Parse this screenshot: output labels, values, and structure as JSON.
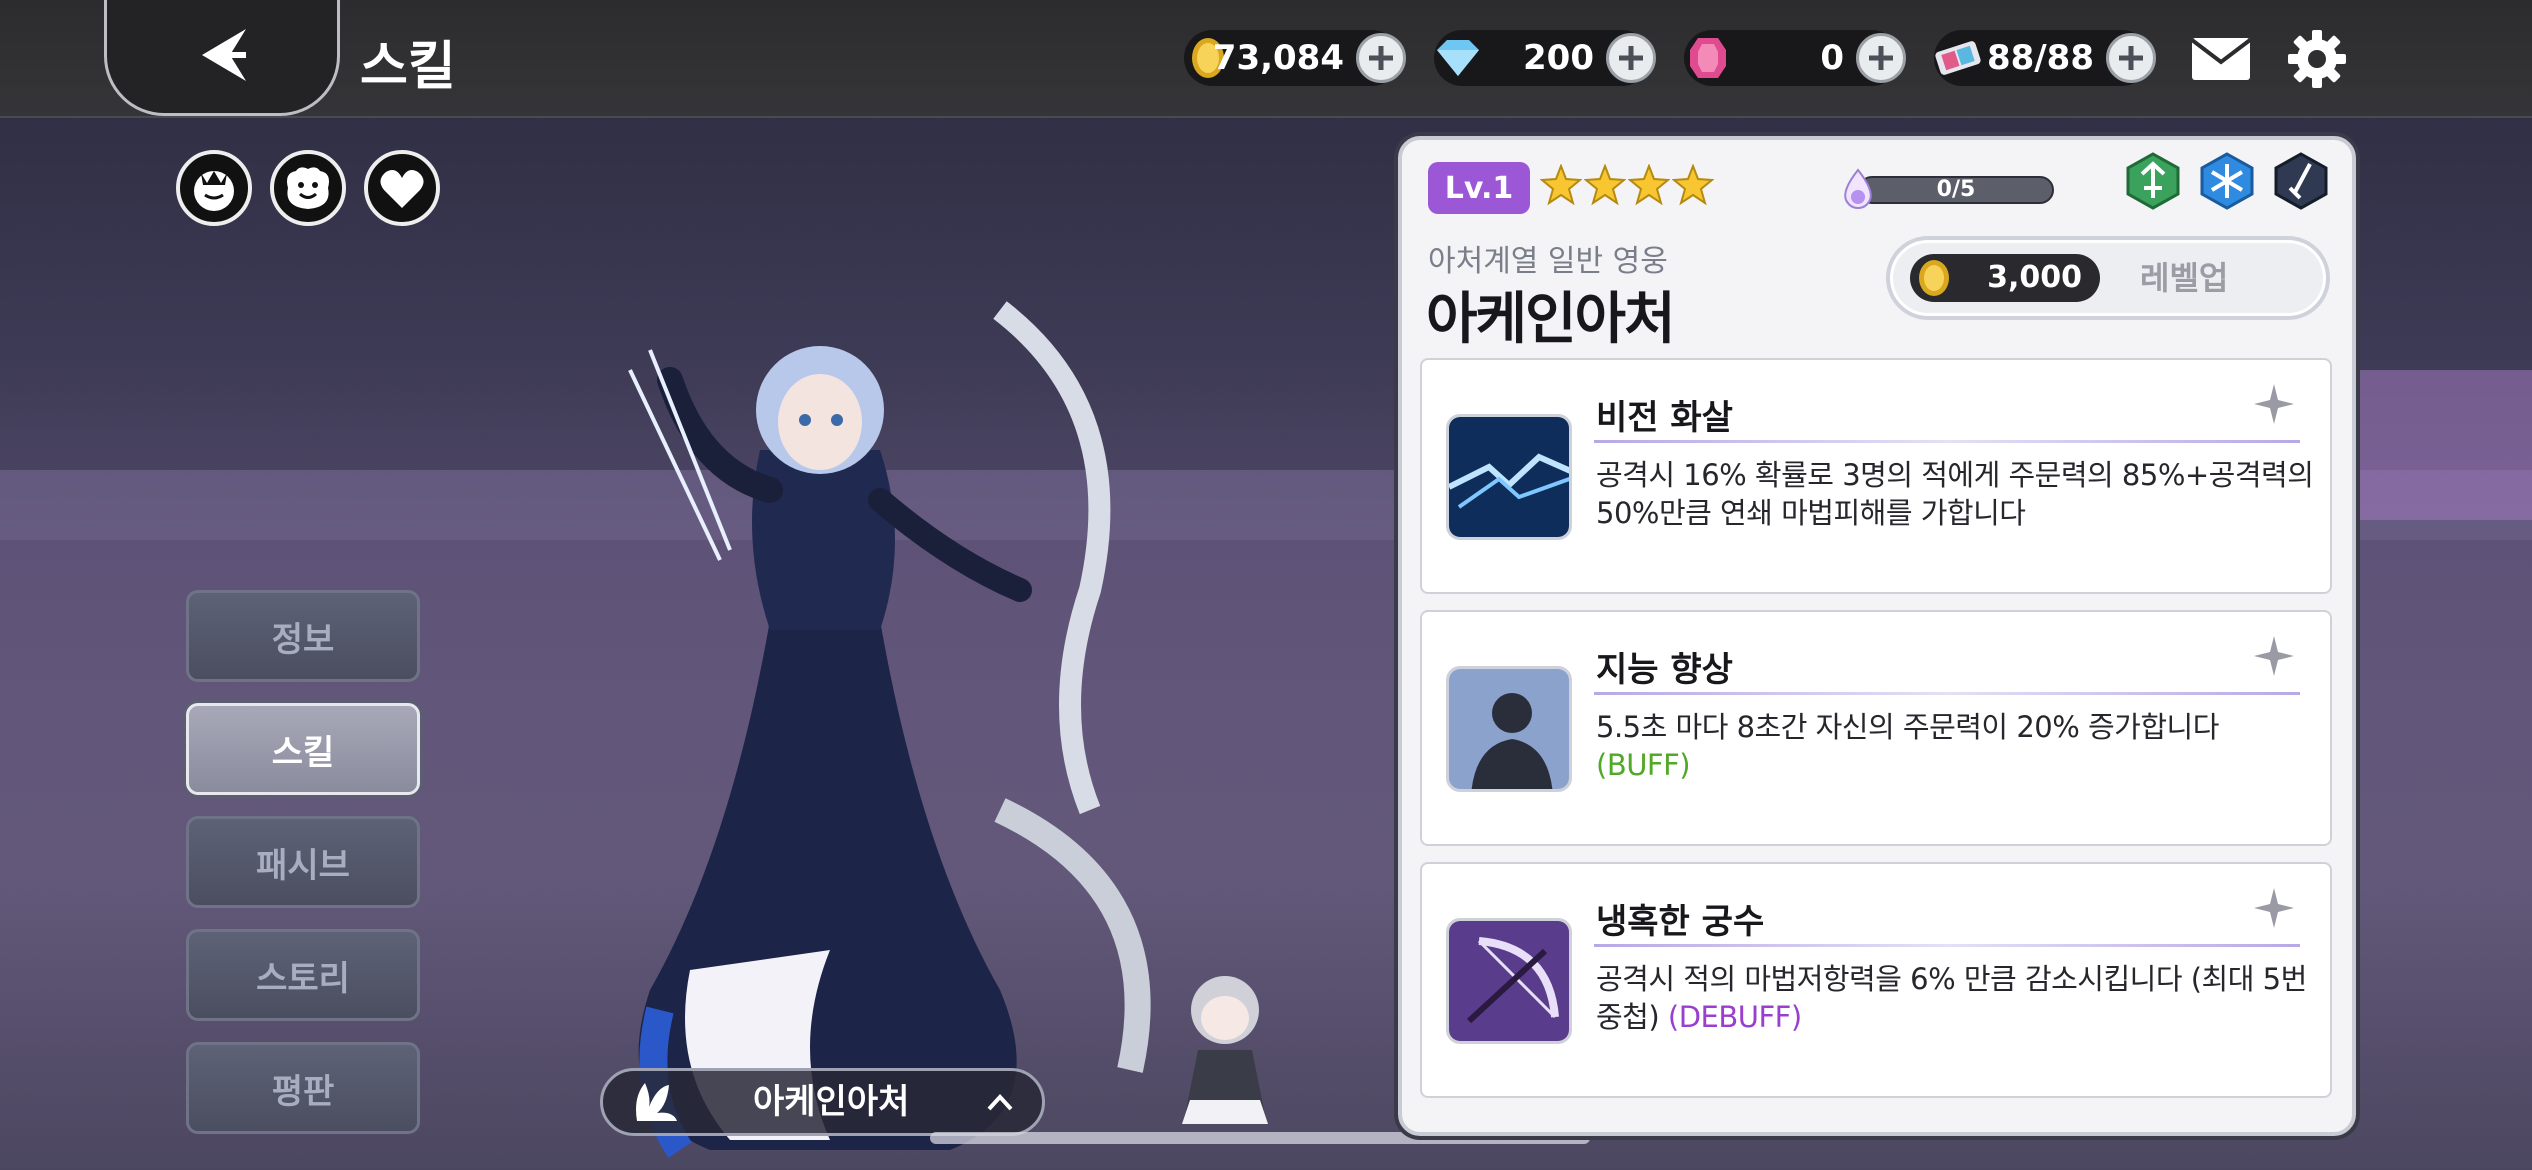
{
  "header": {
    "title": "스킬",
    "currencies": [
      {
        "icon": "gold-coin-icon",
        "value": "73,084"
      },
      {
        "icon": "diamond-icon",
        "value": "200"
      },
      {
        "icon": "ruby-gem-icon",
        "value": "0"
      },
      {
        "icon": "stamina-ticket-icon",
        "value": "88/88"
      }
    ]
  },
  "side_menu": [
    {
      "label": "정보",
      "active": false
    },
    {
      "label": "스킬",
      "active": true
    },
    {
      "label": "패시브",
      "active": false
    },
    {
      "label": "스토리",
      "active": false
    },
    {
      "label": "평판",
      "active": false
    }
  ],
  "character_bar": {
    "name": "아케인아처"
  },
  "hero": {
    "level": "Lv.1",
    "stars": 4,
    "exp": "0/5",
    "subtitle": "아처계열 일반 영웅",
    "name": "아케인아처",
    "levelup_cost": "3,000",
    "levelup_label": "레벨업"
  },
  "skills": [
    {
      "name": "비전 화살",
      "desc": "공격시 16% 확률로 3명의 적에게 주문력의 85%+공격력의 50%만큼 연쇄 마법피해를 가합니다",
      "tag": ""
    },
    {
      "name": "지능 향상",
      "desc": "5.5초 마다 8초간 자신의 주문력이 20% 증가합니다 ",
      "tag": "(BUFF)"
    },
    {
      "name": "냉혹한 궁수",
      "desc": "공격시 적의 마법저항력을 6% 만큼 감소시킵니다 (최대 5번 중첩) ",
      "tag": "(DEBUFF)"
    }
  ],
  "colors": {
    "level_badge": "#9b57d6",
    "buff": "#52a827",
    "debuff": "#9a3ed0"
  }
}
